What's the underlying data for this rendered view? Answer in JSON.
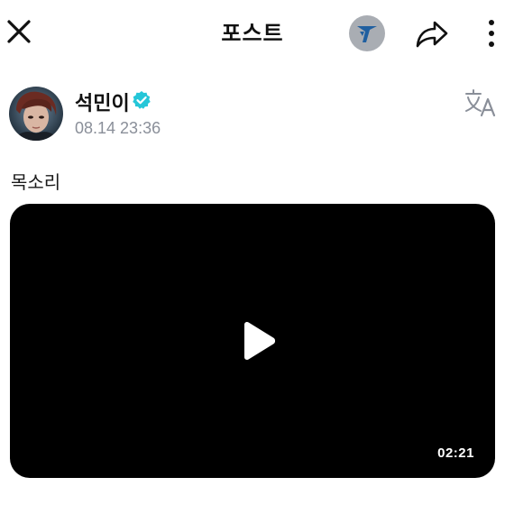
{
  "header": {
    "title": "포스트"
  },
  "icons": {
    "close": "close-icon",
    "community": "community-logo-icon",
    "share": "share-icon",
    "more": "more-vertical-icon",
    "verified": "verified-badge-icon",
    "translate": "translate-icon",
    "play": "play-icon"
  },
  "post": {
    "author": {
      "name": "석민이",
      "verified": true
    },
    "timestamp": "08.14 23:36",
    "text": "목소리",
    "video": {
      "duration": "02:21"
    }
  },
  "colors": {
    "verified_badge": "#25c6d8",
    "timestamp": "#8a8f99",
    "video_background": "#000000",
    "community_icon_background": "#a9adb3",
    "community_icon_mark": "#1f5fa0"
  }
}
